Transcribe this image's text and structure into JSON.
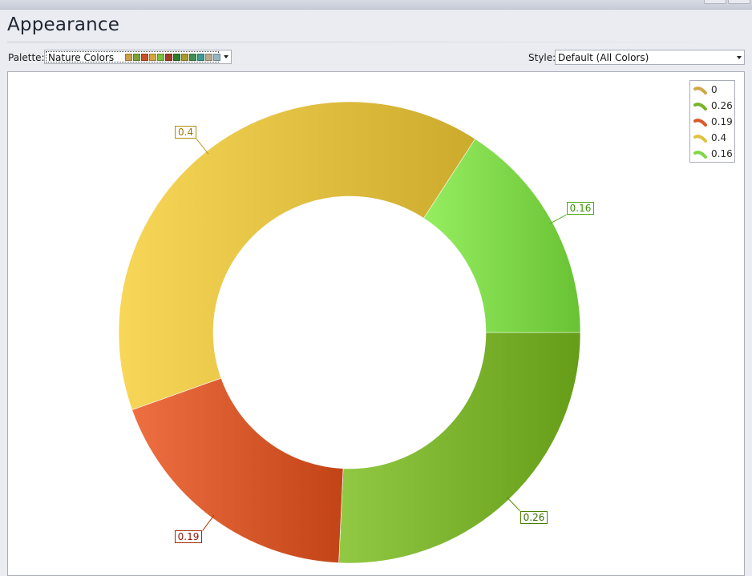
{
  "window": {
    "title": "Appearance"
  },
  "controls": {
    "palette_label": "Palette:",
    "palette_value": "Nature Colors",
    "palette_swatches": [
      "#c8a04a",
      "#7aa33a",
      "#c8512a",
      "#d1a63d",
      "#7bbd3f",
      "#a33d2a",
      "#2f7d2a",
      "#a89a2b",
      "#3f8e55",
      "#3b9a92",
      "#b9a98a",
      "#93b5c4"
    ],
    "style_label": "Style:",
    "style_value": "Default (All Colors)"
  },
  "chart_data": {
    "type": "doughnut",
    "series": [
      {
        "name": "0",
        "value": 0,
        "color": "#d1a848",
        "label": ""
      },
      {
        "name": "0.26",
        "value": 0.26,
        "color": "#7bb32e",
        "label": "0.26"
      },
      {
        "name": "0.19",
        "value": 0.19,
        "color": "#d85a2c",
        "label": "0.19"
      },
      {
        "name": "0.4",
        "value": 0.4,
        "color": "#e2c042",
        "label": "0.4"
      },
      {
        "name": "0.16",
        "value": 0.16,
        "color": "#7fd84a",
        "label": "0.16"
      }
    ],
    "legend": {
      "position": "top-right",
      "entries": [
        "0",
        "0.26",
        "0.19",
        "0.4",
        "0.16"
      ]
    }
  }
}
